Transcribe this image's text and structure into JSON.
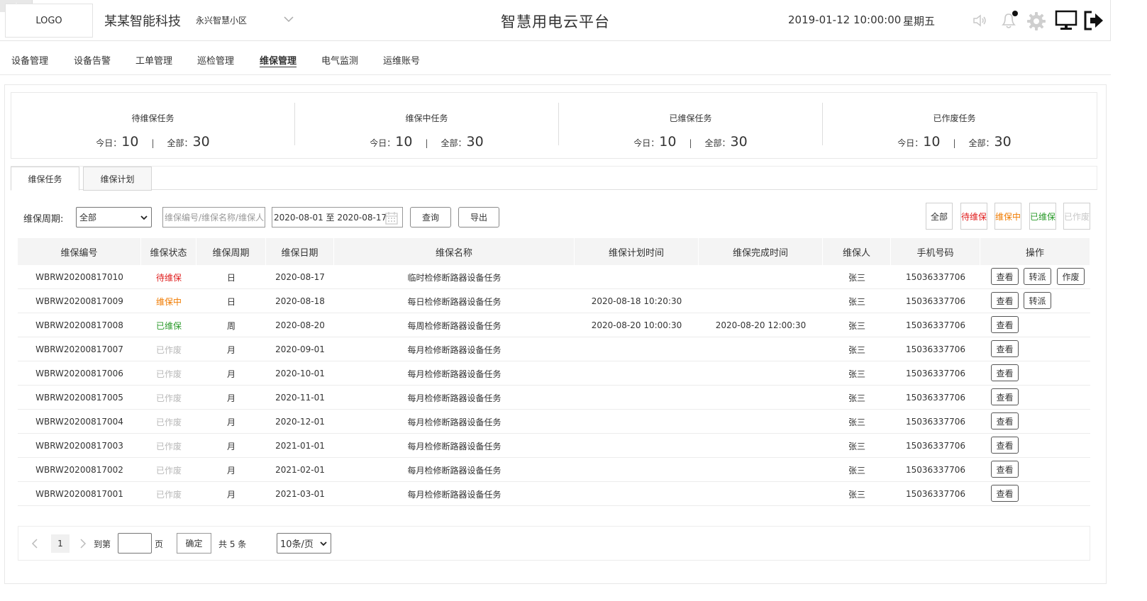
{
  "header": {
    "logo": "LOGO",
    "company": "某某智能科技",
    "community": "永兴智慧小区",
    "platform_title": "智慧用电云平台",
    "datetime": "2019-01-12 10:00:00",
    "weekday": "星期五"
  },
  "nav": {
    "items": [
      {
        "label": "设备管理",
        "active": false
      },
      {
        "label": "设备告警",
        "active": false
      },
      {
        "label": "工单管理",
        "active": false
      },
      {
        "label": "巡检管理",
        "active": false
      },
      {
        "label": "维保管理",
        "active": true
      },
      {
        "label": "电气监测",
        "active": false
      },
      {
        "label": "运维账号",
        "active": false
      }
    ]
  },
  "stats": {
    "today_label": "今日：",
    "total_label": "全部：",
    "separator": "|",
    "cards": [
      {
        "title": "待维保任务",
        "today": "10",
        "total": "30"
      },
      {
        "title": "维保中任务",
        "today": "10",
        "total": "30"
      },
      {
        "title": "已维保任务",
        "today": "10",
        "total": "30"
      },
      {
        "title": "已作废任务",
        "today": "10",
        "total": "30"
      }
    ]
  },
  "tabs": [
    {
      "label": "维保任务",
      "active": true
    },
    {
      "label": "维保计划",
      "active": false
    }
  ],
  "filters": {
    "period_label": "维保周期:",
    "period_value": "全部",
    "search_placeholder": "维保编号/维保名称/维保人",
    "date_range": "2020-08-01 至 2020-08-17",
    "query_label": "查询",
    "export_label": "导出"
  },
  "status_filters": {
    "all": "全部",
    "pending": "待维保",
    "in_progress": "维保中",
    "done": "已维保",
    "void": "已作废"
  },
  "colors": {
    "pending": "#e02020",
    "in_progress": "#f07b00",
    "done": "#2a9a2a",
    "void": "#b8b8b8"
  },
  "table": {
    "columns": [
      "维保编号",
      "维保状态",
      "维保周期",
      "维保日期",
      "维保名称",
      "维保计划时间",
      "维保完成时间",
      "维保人",
      "手机号码",
      "操作"
    ],
    "action_labels": {
      "view": "查看",
      "transfer": "转派",
      "void": "作废"
    },
    "rows": [
      {
        "id": "WBRW20200817010",
        "status": "待维保",
        "status_class": "st-red",
        "period": "日",
        "date": "2020-08-17",
        "name": "临时检修断路器设备任务",
        "plan_time": "",
        "done_time": "",
        "person": "张三",
        "phone": "15036337706",
        "actions": [
          "view",
          "transfer",
          "void"
        ]
      },
      {
        "id": "WBRW20200817009",
        "status": "维保中",
        "status_class": "st-orange",
        "period": "日",
        "date": "2020-08-18",
        "name": "每日检修断路器设备任务",
        "plan_time": "2020-08-18 10:20:30",
        "done_time": "",
        "person": "张三",
        "phone": "15036337706",
        "actions": [
          "view",
          "transfer"
        ]
      },
      {
        "id": "WBRW20200817008",
        "status": "已维保",
        "status_class": "st-green",
        "period": "周",
        "date": "2020-08-20",
        "name": "每周检修断路器设备任务",
        "plan_time": "2020-08-20 10:00:30",
        "done_time": "2020-08-20 12:00:30",
        "person": "张三",
        "phone": "15036337706",
        "actions": [
          "view"
        ]
      },
      {
        "id": "WBRW20200817007",
        "status": "已作废",
        "status_class": "st-gray",
        "period": "月",
        "date": "2020-09-01",
        "name": "每月检修断路器设备任务",
        "plan_time": "",
        "done_time": "",
        "person": "张三",
        "phone": "15036337706",
        "actions": [
          "view"
        ]
      },
      {
        "id": "WBRW20200817006",
        "status": "已作废",
        "status_class": "st-gray",
        "period": "月",
        "date": "2020-10-01",
        "name": "每月检修断路器设备任务",
        "plan_time": "",
        "done_time": "",
        "person": "张三",
        "phone": "15036337706",
        "actions": [
          "view"
        ]
      },
      {
        "id": "WBRW20200817005",
        "status": "已作废",
        "status_class": "st-gray",
        "period": "月",
        "date": "2020-11-01",
        "name": "每月检修断路器设备任务",
        "plan_time": "",
        "done_time": "",
        "person": "张三",
        "phone": "15036337706",
        "actions": [
          "view"
        ]
      },
      {
        "id": "WBRW20200817004",
        "status": "已作废",
        "status_class": "st-gray",
        "period": "月",
        "date": "2020-12-01",
        "name": "每月检修断路器设备任务",
        "plan_time": "",
        "done_time": "",
        "person": "张三",
        "phone": "15036337706",
        "actions": [
          "view"
        ]
      },
      {
        "id": "WBRW20200817003",
        "status": "已作废",
        "status_class": "st-gray",
        "period": "月",
        "date": "2021-01-01",
        "name": "每月检修断路器设备任务",
        "plan_time": "",
        "done_time": "",
        "person": "张三",
        "phone": "15036337706",
        "actions": [
          "view"
        ]
      },
      {
        "id": "WBRW20200817002",
        "status": "已作废",
        "status_class": "st-gray",
        "period": "月",
        "date": "2021-02-01",
        "name": "每月检修断路器设备任务",
        "plan_time": "",
        "done_time": "",
        "person": "张三",
        "phone": "15036337706",
        "actions": [
          "view"
        ]
      },
      {
        "id": "WBRW20200817001",
        "status": "已作废",
        "status_class": "st-gray",
        "period": "月",
        "date": "2021-03-01",
        "name": "每月检修断路器设备任务",
        "plan_time": "",
        "done_time": "",
        "person": "张三",
        "phone": "15036337706",
        "actions": [
          "view"
        ]
      }
    ]
  },
  "pagination": {
    "current_page": "1",
    "goto_label": "到第",
    "page_unit": "页",
    "confirm_label": "确定",
    "total_label": "共 5 条",
    "page_size": "10条/页"
  }
}
